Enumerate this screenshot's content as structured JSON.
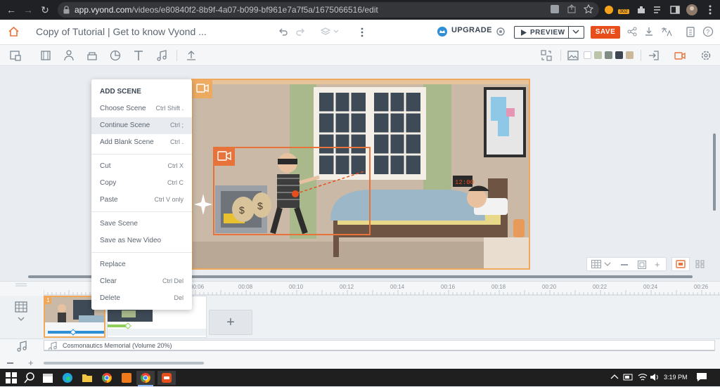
{
  "browser": {
    "url_host": "app.vyond.com",
    "url_path": "/videos/e80840f2-8b9f-4a07-b099-bf961e7a7f5a/1675066516/edit",
    "badge_count": "302"
  },
  "header": {
    "doc_title": "Copy of Tutorial | Get to know Vyond ...",
    "upgrade_label": "UPGRADE",
    "preview_label": "PREVIEW",
    "save_label": "SAVE"
  },
  "toolbar": {
    "swatches": [
      "#ffffff",
      "#b9c4a8",
      "#7f8d85",
      "#3d4550",
      "#cbb89a"
    ]
  },
  "context_menu": {
    "heading": "ADD SCENE",
    "items": [
      {
        "label": "Choose Scene",
        "shortcut": "Ctrl Shift ."
      },
      {
        "label": "Continue Scene",
        "shortcut": "Ctrl ;"
      },
      {
        "label": "Add Blank Scene",
        "shortcut": "Ctrl ."
      },
      {
        "label": "Cut",
        "shortcut": "Ctrl X"
      },
      {
        "label": "Copy",
        "shortcut": "Ctrl C"
      },
      {
        "label": "Paste",
        "shortcut": "Ctrl V only"
      },
      {
        "label": "Save Scene",
        "shortcut": ""
      },
      {
        "label": "Save as New Video",
        "shortcut": ""
      },
      {
        "label": "Replace",
        "shortcut": ""
      },
      {
        "label": "Clear",
        "shortcut": "Ctrl Del"
      },
      {
        "label": "Delete",
        "shortcut": "Del"
      }
    ]
  },
  "timeline": {
    "ruler_labels": [
      "00:06",
      "00:08",
      "00:10",
      "00:12",
      "00:14",
      "00:16",
      "00:18",
      "00:20",
      "00:22",
      "00:24",
      "00:26"
    ],
    "scene_number": "1",
    "audio_label": "Cosmonautics Memorial (Volume 20%)",
    "add_scene_glyph": "+"
  },
  "scene_art": {
    "clock_text": "12:00",
    "sign_symbol": "$"
  },
  "taskbar": {
    "time": "3:19 PM"
  }
}
